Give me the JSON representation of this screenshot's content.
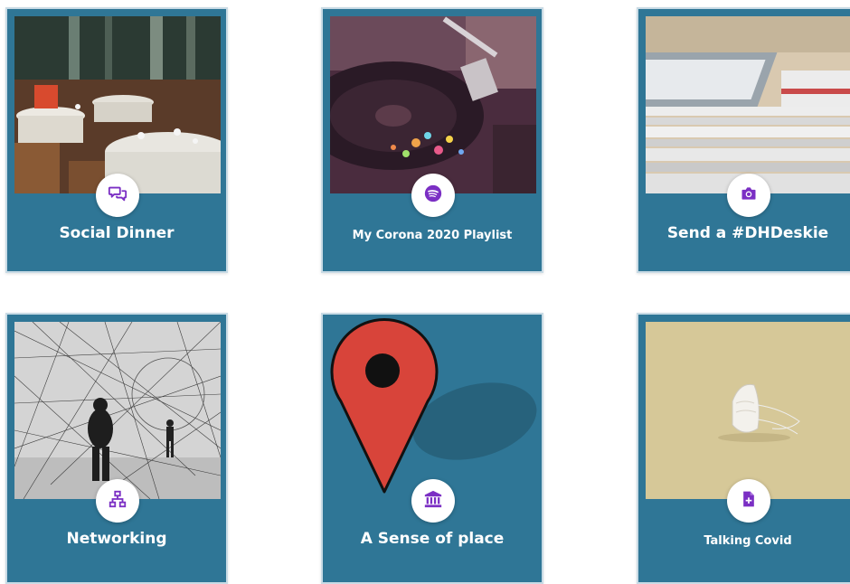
{
  "cards": [
    {
      "title": "Social Dinner",
      "icon": "chat-bubbles-icon"
    },
    {
      "title": "My Corona 2020 Playlist",
      "icon": "spotify-icon"
    },
    {
      "title": "Send a #DHDeskie",
      "icon": "camera-icon"
    },
    {
      "title": "Networking",
      "icon": "network-icon"
    },
    {
      "title": "A Sense of place",
      "icon": "museum-icon"
    },
    {
      "title": "Talking Covid",
      "icon": "medical-document-icon"
    }
  ],
  "colors": {
    "card_bg": "#2f7696",
    "icon_accent": "#7b2fc4",
    "border": "#c9dbe5"
  }
}
